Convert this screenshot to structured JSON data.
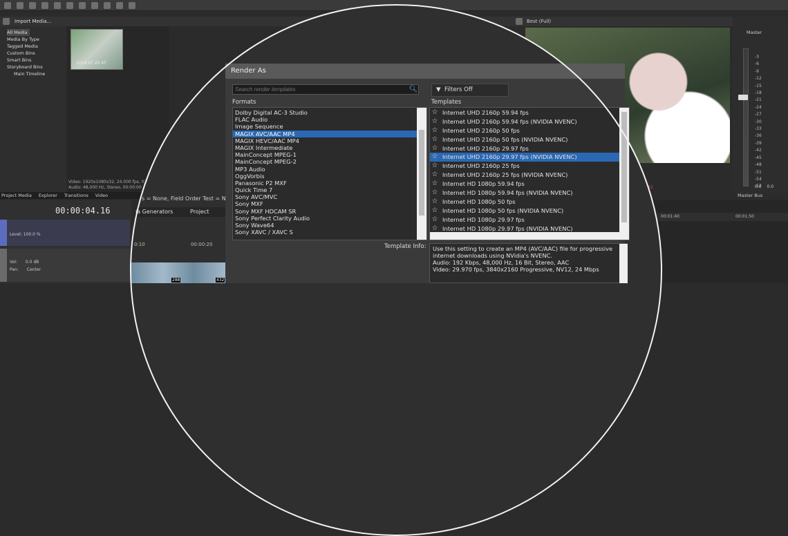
{
  "toolbar": {
    "import_label": "Import Media..."
  },
  "tree": {
    "items": [
      "All Media",
      "Media By Type",
      "Tagged Media",
      "Custom Bins",
      "Smart Bins",
      "Storyboard Bins",
      "Main Timeline"
    ]
  },
  "media": {
    "thumb_label": "2018 07 20 4T ",
    "info_line1": "Video: 1920x1080x32, 24.000 fps, 02",
    "info_line2": "Audio: 48,000 Hz, Stereo, 00:00:00"
  },
  "tabs": [
    "Project Media",
    "Explorer",
    "Transitions",
    "Video"
  ],
  "timecode": "00:00:04.16",
  "track1": {
    "level": "Level: 100.0 %"
  },
  "track2": {
    "vol_label": "Vol:",
    "vol_value": "0.0 dB",
    "pan_label": "Pan:",
    "pan_value": "Center"
  },
  "preview": {
    "quality": "Best (Full)",
    "size_tag": "38x32"
  },
  "master": {
    "label": "Master",
    "bus_label": "Master Bus"
  },
  "meter_scale": [
    "-3",
    "-6",
    "-9",
    "-12",
    "-15",
    "-18",
    "-21",
    "-24",
    "-27",
    "-30",
    "-33",
    "-36",
    "-39",
    "-42",
    "-45",
    "-48",
    "-51",
    "-54",
    "-57"
  ],
  "meter_bottom": [
    "0.0",
    "0.0"
  ],
  "ruler": [
    "00:01:40",
    "00:01:50"
  ],
  "behind": {
    "field_text": "s = None, Field Order Test = N",
    "tab_generators": "ia Generators",
    "tab_project": "Project",
    "ruler_left": "0:10",
    "ruler_right": "00:00:20",
    "frame_a": "288",
    "frame_b": "432"
  },
  "dialog": {
    "title": "Render As",
    "search_placeholder": "Search render templates",
    "filters_label": "Filters Off",
    "formats_label": "Formats",
    "templates_label": "Templates",
    "template_info_label": "Template Info:",
    "formats": [
      "Dolby Digital AC-3 Studio",
      "FLAC Audio",
      "Image Sequence",
      "MAGIX AVC/AAC MP4",
      "MAGIX HEVC/AAC MP4",
      "MAGIX Intermediate",
      "MainConcept MPEG-1",
      "MainConcept MPEG-2",
      "MP3 Audio",
      "OggVorbis",
      "Panasonic P2 MXF",
      "Quick Time 7",
      "Sony AVC/MVC",
      "Sony MXF",
      "Sony MXF HDCAM SR",
      "Sony Perfect Clarity Audio",
      "Sony Wave64",
      "Sony XAVC / XAVC S"
    ],
    "selected_format": 3,
    "templates": [
      "Internet UHD 2160p 59.94 fps",
      "Internet UHD 2160p 59.94 fps (NVIDIA NVENC)",
      "Internet UHD 2160p 50 fps",
      "Internet UHD 2160p 50 fps (NVIDIA NVENC)",
      "Internet UHD 2160p 29.97 fps",
      "Internet UHD 2160p 29.97 fps (NVIDIA NVENC)",
      "Internet UHD 2160p 25 fps",
      "Internet UHD 2160p 25 fps (NVIDIA NVENC)",
      "Internet HD 1080p 59.94 fps",
      "Internet HD 1080p 59.94 fps (NVIDIA NVENC)",
      "Internet HD 1080p 50 fps",
      "Internet HD 1080p 50 fps (NVIDIA NVENC)",
      "Internet HD 1080p 29.97 fps",
      "Internet HD 1080p 29.97 fps (NVIDIA NVENC)"
    ],
    "selected_template": 5,
    "info_lines": [
      "Use this setting to create an MP4 (AVC/AAC) file for progressive",
      "internet downloads using NVidia's NVENC.",
      "Audio: 192 Kbps, 48,000 Hz, 16 Bit, Stereo, AAC",
      "Video: 29.970 fps, 3840x2160 Progressive, NV12, 24 Mbps"
    ]
  }
}
